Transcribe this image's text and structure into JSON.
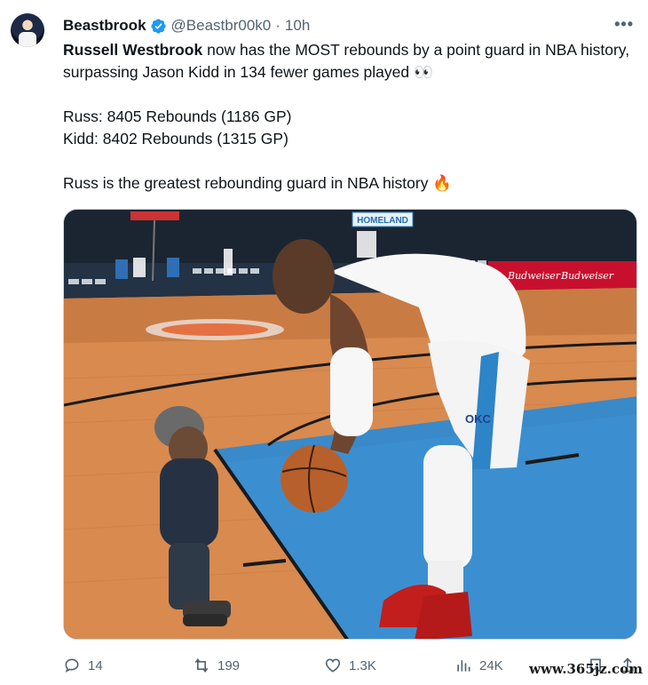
{
  "author": {
    "display_name": "Beastbrook",
    "handle": "@Beastbr00k0",
    "separator": "·",
    "time": "10h",
    "verified": true
  },
  "tweet": {
    "lines": [
      [
        "Russell Westbrook",
        " now has the MOST rebounds by a point guard in NBA history, surpassing Jason Kidd in 134 fewer games played 👀"
      ],
      "Russ: 8405 Rebounds (1186 GP)",
      "Kidd: 8402 Rebounds (1315 GP)",
      "Russ is the greatest rebounding guard in NBA history 🔥"
    ],
    "bold_name": "Russell Westbrook",
    "line1_rest": " now has the MOST rebounds by a point guard in NBA history, surpassing Jason Kidd in 134 fewer games played 👀",
    "line2": "Russ: 8405 Rebounds (1186 GP)",
    "line3": "Kidd: 8402 Rebounds (1315 GP)",
    "line4": "Russ is the greatest rebounding guard in NBA history 🔥"
  },
  "media": {
    "arena_sign": "HOMELAND",
    "courtside_ad": "Budweiser",
    "jersey_logo": "OKC"
  },
  "actions": {
    "replies": "14",
    "reposts": "199",
    "likes": "1.3K",
    "views": "24K"
  },
  "watermark": "www.365jz.com",
  "colors": {
    "verified": "#1d9bf0",
    "muted": "#536471",
    "text": "#0f1419"
  }
}
